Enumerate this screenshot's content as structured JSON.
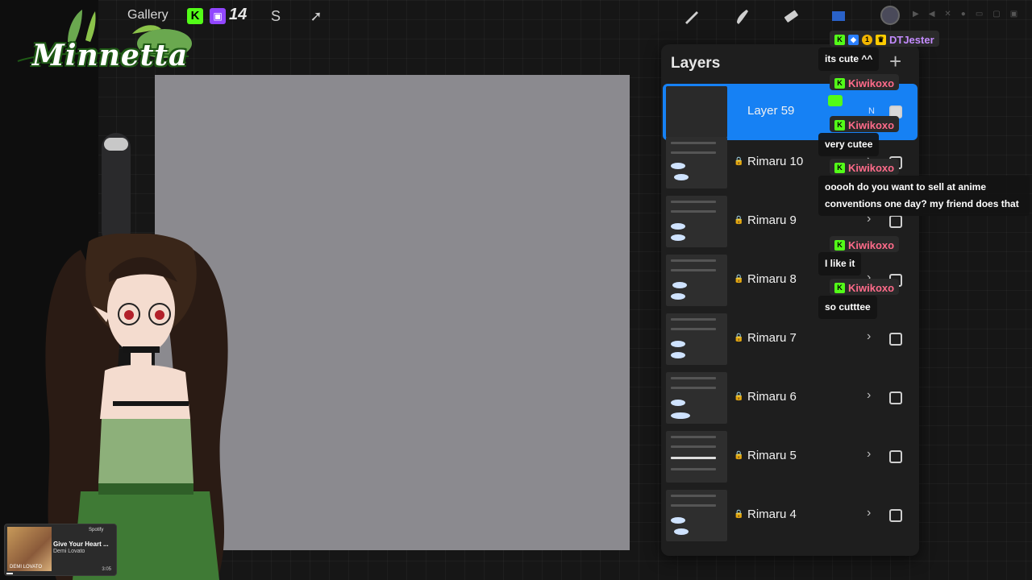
{
  "topbar": {
    "gallery_label": "Gallery",
    "kick_icon": "kick-icon",
    "twitch_icon": "twitch-icon",
    "viewer_count": "14",
    "tools": [
      "wrench-icon",
      "smudge-icon",
      "move-icon",
      "brush-icon",
      "smudge-tool-icon",
      "eraser-icon",
      "layers-icon"
    ]
  },
  "logo": {
    "text": "Minnetta"
  },
  "layers_panel": {
    "title": "Layers",
    "add_label": "+",
    "rows": [
      {
        "name": "Layer 59",
        "active": true,
        "checked": true,
        "blend": "N",
        "locked": false
      },
      {
        "name": "Rimaru 10",
        "active": false,
        "checked": false,
        "locked": true
      },
      {
        "name": "Rimaru 9",
        "active": false,
        "checked": false,
        "locked": true
      },
      {
        "name": "Rimaru 8",
        "active": false,
        "checked": false,
        "locked": true
      },
      {
        "name": "Rimaru 7",
        "active": false,
        "checked": false,
        "locked": true
      },
      {
        "name": "Rimaru 6",
        "active": false,
        "checked": false,
        "locked": true
      },
      {
        "name": "Rimaru 5",
        "active": false,
        "checked": false,
        "locked": true
      },
      {
        "name": "Rimaru 4",
        "active": false,
        "checked": false,
        "locked": true
      }
    ]
  },
  "chat": {
    "messages": [
      {
        "user": "DTJester",
        "user_color": "#c48cff",
        "text": "its cute ^^"
      },
      {
        "user": "Kiwikoxo",
        "user_color": "#ff6b8a",
        "text": ""
      },
      {
        "user": "Kiwikoxo",
        "user_color": "#ff6b8a",
        "text": "very cutee"
      },
      {
        "user": "Kiwikoxo",
        "user_color": "#ff6b8a",
        "text": "ooooh do you want to sell at anime conventions one day? my friend does that"
      },
      {
        "user": "Kiwikoxo",
        "user_color": "#ff6b8a",
        "text": "I like it"
      },
      {
        "user": "Kiwikoxo",
        "user_color": "#ff6b8a",
        "text": "so cutttee"
      }
    ]
  },
  "music": {
    "service": "Spotify",
    "song": "Give Your Heart ...",
    "artist": "Demi Lovato",
    "album_label": "DEMI LOVATO",
    "duration": "3:05"
  },
  "colors": {
    "accent": "#1681f4",
    "canvas": "#8b8a8f",
    "kick": "#53fc18",
    "twitch": "#9146ff"
  }
}
